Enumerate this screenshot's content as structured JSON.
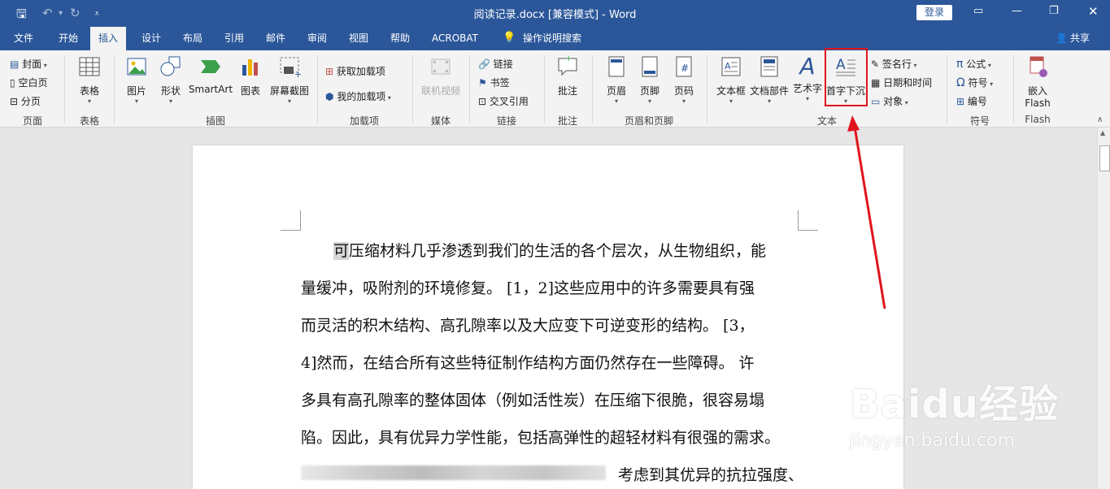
{
  "window": {
    "title": "阅读记录.docx [兼容模式]  -  Word",
    "login": "登录",
    "share": "共享"
  },
  "tabs": [
    "文件",
    "开始",
    "插入",
    "设计",
    "布局",
    "引用",
    "邮件",
    "审阅",
    "视图",
    "帮助",
    "ACROBAT",
    "操作说明搜索"
  ],
  "ribbon": {
    "page_group": {
      "label": "页面",
      "items": [
        "封面",
        "空白页",
        "分页"
      ]
    },
    "table_group": {
      "label": "表格",
      "items": [
        "表格"
      ]
    },
    "illustration_group": {
      "label": "插图",
      "items": [
        "图片",
        "形状",
        "SmartArt",
        "图表",
        "屏幕截图"
      ]
    },
    "addins_group": {
      "label": "加载项",
      "items": [
        "获取加载项",
        "我的加载项"
      ]
    },
    "media_group": {
      "label": "媒体",
      "items": [
        "联机视频"
      ]
    },
    "links_group": {
      "label": "链接",
      "items": [
        "链接",
        "书签",
        "交叉引用"
      ]
    },
    "comments_group": {
      "label": "批注",
      "items": [
        "批注"
      ]
    },
    "header_group": {
      "label": "页眉和页脚",
      "items": [
        "页眉",
        "页脚",
        "页码"
      ]
    },
    "text_group": {
      "label": "文本",
      "items": [
        "文本框",
        "文档部件",
        "艺术字",
        "首字下沉",
        "签名行",
        "日期和时间",
        "对象"
      ]
    },
    "symbols_group": {
      "label": "符号",
      "items": [
        "公式",
        "符号",
        "编号"
      ]
    },
    "flash_group": {
      "label": "Flash",
      "items": [
        "嵌入",
        "Flash"
      ]
    }
  },
  "document": {
    "first_char": "可",
    "lines": [
      "压缩材料几乎渗透到我们的生活的各个层次，从生物组织，能",
      "量缓冲，吸附剂的环境修复。 [1，2]这些应用中的许多需要具有强",
      "而灵活的积木结构、高孔隙率以及大应变下可逆变形的结构。 [3，",
      "4]然而，在结合所有这些特征制作结构方面仍然存在一些障碍。 许",
      "多具有高孔隙率的整体固体（例如活性炭）在压缩下很脆，很容易塌",
      "陷。因此，具有优异力学性能，包括高弹性的超轻材料有很强的需求。",
      "考虑到其优异的抗拉强度、"
    ]
  },
  "watermark": {
    "brand": "Baidu",
    "cn": "经验",
    "url": "jingyan.baidu.com"
  }
}
